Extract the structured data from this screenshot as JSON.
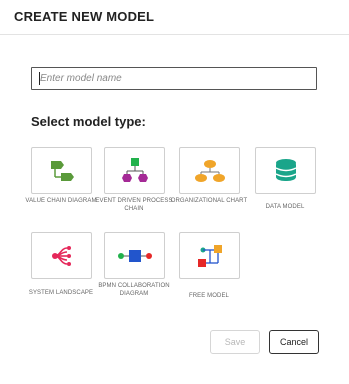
{
  "dialog": {
    "title": "CREATE NEW MODEL",
    "name_placeholder": "Enter model name",
    "name_value": "",
    "section_label": "Select model type:",
    "model_types": [
      {
        "label": "VALUE CHAIN DIAGRAM",
        "icon": "value-chain-icon",
        "color": "#5a9a3a"
      },
      {
        "label": "EVENT DRIVEN PROCESS CHAIN",
        "icon": "epc-icon",
        "color": "#a52a96"
      },
      {
        "label": "ORGANIZATIONAL CHART",
        "icon": "org-chart-icon",
        "color": "#f0a52a"
      },
      {
        "label": "DATA MODEL",
        "icon": "database-icon",
        "color": "#1aa58a"
      },
      {
        "label": "SYSTEM LANDSCAPE",
        "icon": "system-landscape-icon",
        "color": "#e5285a"
      },
      {
        "label": "BPMN COLLABORATION DIAGRAM",
        "icon": "bpmn-icon",
        "color": "#2255cc"
      },
      {
        "label": "FREE MODEL",
        "icon": "free-model-icon",
        "color": "#e52828"
      }
    ],
    "buttons": {
      "save": "Save",
      "cancel": "Cancel"
    },
    "save_enabled": false
  }
}
